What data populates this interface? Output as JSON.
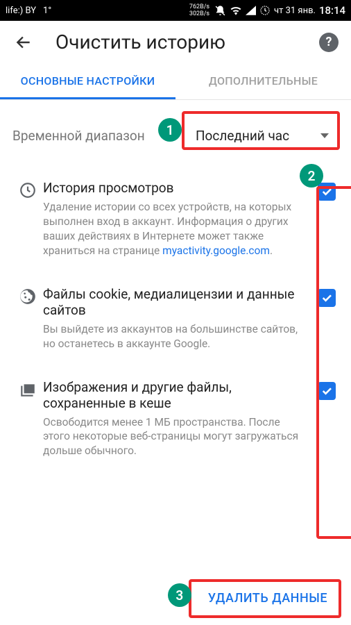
{
  "statusbar": {
    "carrier": "life:) BY",
    "temp": "1°",
    "speed_up": "762B/s",
    "speed_down": "302B/s",
    "date": "чт 31 янв.",
    "time": "18:14"
  },
  "header": {
    "title": "Очистить историю"
  },
  "tabs": {
    "basic": "ОСНОВНЫЕ НАСТРОЙКИ",
    "advanced": "ДОПОЛНИТЕЛЬНЫЕ"
  },
  "range": {
    "label": "Временной диапазон",
    "selected": "Последний час"
  },
  "items": {
    "history": {
      "title": "История просмотров",
      "desc_pre": "Удаление истории со всех устройств, на которых выполнен вход в аккаунт. Информация о других ваших действиях в Интернете может также храниться на странице ",
      "link": "myactivity.google.com",
      "desc_post": "."
    },
    "cookies": {
      "title": "Файлы cookie, медиалицензии и данные сайтов",
      "desc": "Вы выйдете из аккаунтов на большинстве сайтов, но останетесь в аккаунте Google."
    },
    "cache": {
      "title": "Изображения и другие файлы, сохраненные в кеше",
      "desc": "Освободится менее 1 МБ пространства. После этого некоторые веб-страницы могут загружаться дольше обычного."
    }
  },
  "footer": {
    "delete": "УДАЛИТЬ ДАННЫЕ"
  },
  "badges": {
    "b1": "1",
    "b2": "2",
    "b3": "3"
  }
}
